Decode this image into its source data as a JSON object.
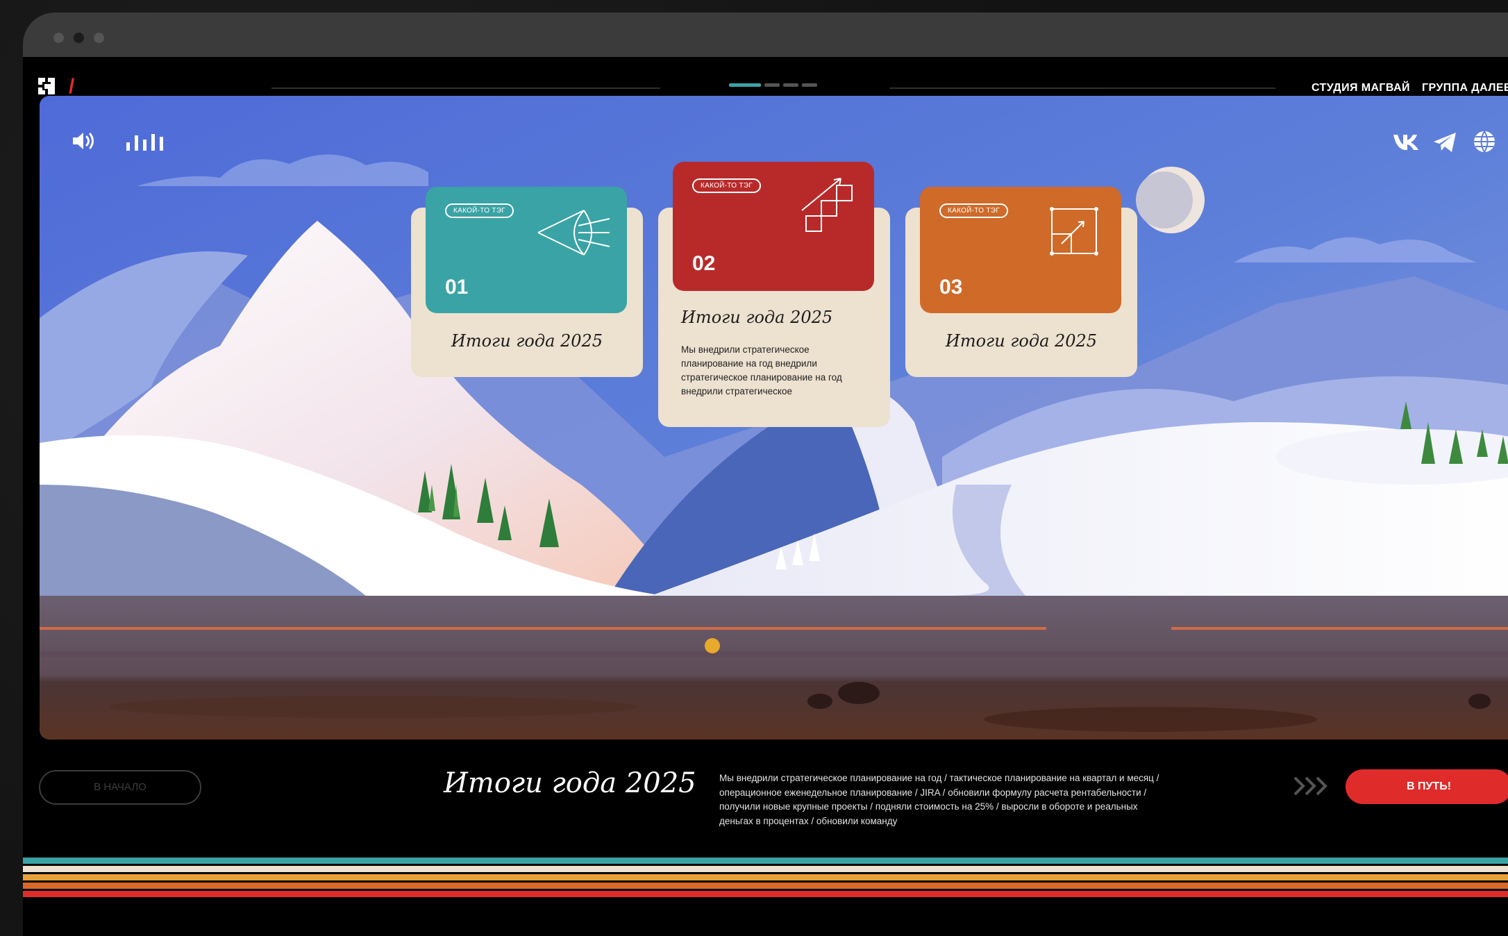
{
  "nav": {
    "links": [
      "СТУДИЯ МАГВАЙ",
      "ГРУППА ДАЛЕЕ"
    ]
  },
  "controls": {
    "sound_icon": "speaker-icon",
    "equalizer_icon": "equalizer-icon",
    "social": [
      "vk-icon",
      "telegram-icon",
      "globe-icon"
    ]
  },
  "cards": [
    {
      "tag": "КАКОЙ-ТО ТЭГ",
      "number": "01",
      "title": "Итоги года 2025",
      "color": "#3aa3a5",
      "icon": "cone-icon"
    },
    {
      "tag": "КАКОЙ-ТО ТЭГ",
      "number": "02",
      "title": "Итоги года 2025",
      "description": "Мы внедрили стратегическое планирование на год внедрили стратегическое планирование на год внедрили стратегическое",
      "color": "#b82a2a",
      "icon": "stairs-icon"
    },
    {
      "tag": "КАКОЙ-ТО ТЭГ",
      "number": "03",
      "title": "Итоги года 2025",
      "color": "#cf6a29",
      "icon": "frame-icon"
    }
  ],
  "bottom": {
    "start_label": "В НАЧАЛО",
    "title": "Итоги года 2025",
    "description": "Мы внедрили стратегическое планирование на год / тактическое планирование на квартал и месяц / операционное еженедельное планирование / JIRA / обновили формулу расчета рентабельности / получили новые крупные проекты / подняли стоимость на 25% / выросли в обороте и реальных деньгах в процентах / обновили команду",
    "go_label": "В ПУТЬ!"
  },
  "colors": {
    "accent": "#e02b2b",
    "stripes": [
      "#3aa3a5",
      "#ede1cf",
      "#e8a23a",
      "#d8692a",
      "#e02b2b"
    ]
  }
}
